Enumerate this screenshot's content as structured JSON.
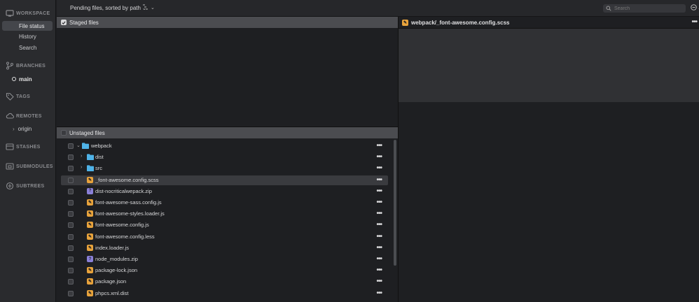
{
  "sidebar": {
    "workspace": {
      "label": "WORKSPACE",
      "items": [
        {
          "label": "File status",
          "selected": true
        },
        {
          "label": "History"
        },
        {
          "label": "Search"
        }
      ]
    },
    "branches": {
      "label": "BRANCHES",
      "current": "main"
    },
    "tags": {
      "label": "TAGS"
    },
    "remotes": {
      "label": "REMOTES",
      "items": [
        "origin"
      ]
    },
    "stashes": {
      "label": "STASHES"
    },
    "submodules": {
      "label": "SUBMODULES"
    },
    "subtrees": {
      "label": "SUBTREES"
    }
  },
  "toolbar": {
    "sort_label": "Pending files, sorted by path",
    "search_placeholder": "Search"
  },
  "staged": {
    "label": "Staged files"
  },
  "unstaged": {
    "label": "Unstaged files",
    "rows": [
      {
        "name": "webpack",
        "type": "folder",
        "expanded": true
      },
      {
        "name": "dist",
        "type": "folder"
      },
      {
        "name": "src",
        "type": "folder"
      },
      {
        "name": "_font-awesome.config.scss",
        "type": "modified",
        "selected": true
      },
      {
        "name": "dist-nocriticalwepack.zip",
        "type": "unknown"
      },
      {
        "name": "font-awesome-sass.config.js",
        "type": "modified"
      },
      {
        "name": "font-awesome-styles.loader.js",
        "type": "modified"
      },
      {
        "name": "font-awesome.config.js",
        "type": "modified"
      },
      {
        "name": "font-awesome.config.less",
        "type": "modified"
      },
      {
        "name": "index.loader.js",
        "type": "modified"
      },
      {
        "name": "node_modules.zip",
        "type": "unknown"
      },
      {
        "name": "package-lock.json",
        "type": "modified"
      },
      {
        "name": "package.json",
        "type": "modified"
      },
      {
        "name": "phpcs.xml.dist",
        "type": "modified"
      }
    ]
  },
  "diff": {
    "title": "webpack/_font-awesome.config.scss"
  },
  "colors": {
    "modified": "#e8a33c",
    "unknown": "#8a80d8",
    "folder": "#4fb3e8"
  }
}
